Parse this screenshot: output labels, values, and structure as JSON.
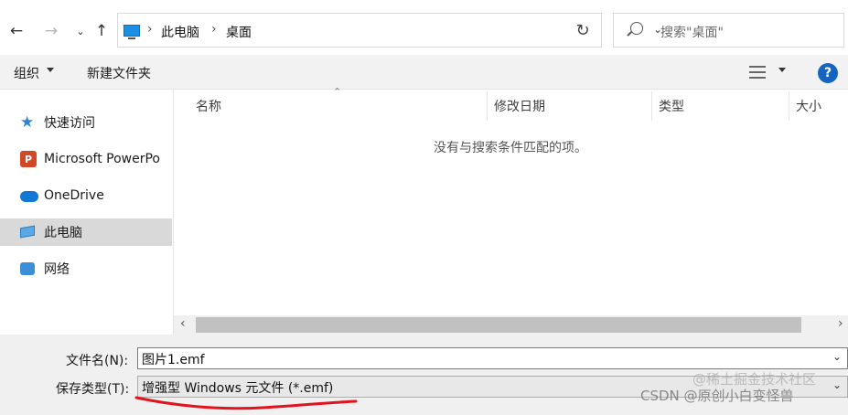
{
  "address": {
    "crumbs": [
      "此电脑",
      "桌面"
    ]
  },
  "search": {
    "placeholder": "搜索\"桌面\""
  },
  "toolbar": {
    "organize": "组织",
    "new_folder": "新建文件夹",
    "help": "?"
  },
  "sidebar": {
    "items": [
      {
        "label": "快速访问",
        "icon": "quick-access-star-icon"
      },
      {
        "label": "Microsoft PowerPo",
        "icon": "powerpoint-icon"
      },
      {
        "label": "OneDrive",
        "icon": "onedrive-cloud-icon"
      },
      {
        "label": "此电脑",
        "icon": "this-pc-icon",
        "selected": true
      },
      {
        "label": "网络",
        "icon": "network-icon"
      }
    ]
  },
  "columns": [
    "名称",
    "修改日期",
    "类型",
    "大小"
  ],
  "empty_message": "没有与搜索条件匹配的项。",
  "form": {
    "filename_label": "文件名(N):",
    "filename_value": "图片1.emf",
    "filetype_label": "保存类型(T):",
    "filetype_value": "增强型 Windows 元文件 (*.emf)"
  },
  "watermark": {
    "line1": "@稀土掘金技术社区",
    "line2": "CSDN @原创小白变怪兽"
  },
  "colors": {
    "accent": "#1565c0",
    "selection": "#d9d9d9",
    "annotation_red": "#e0141e"
  }
}
